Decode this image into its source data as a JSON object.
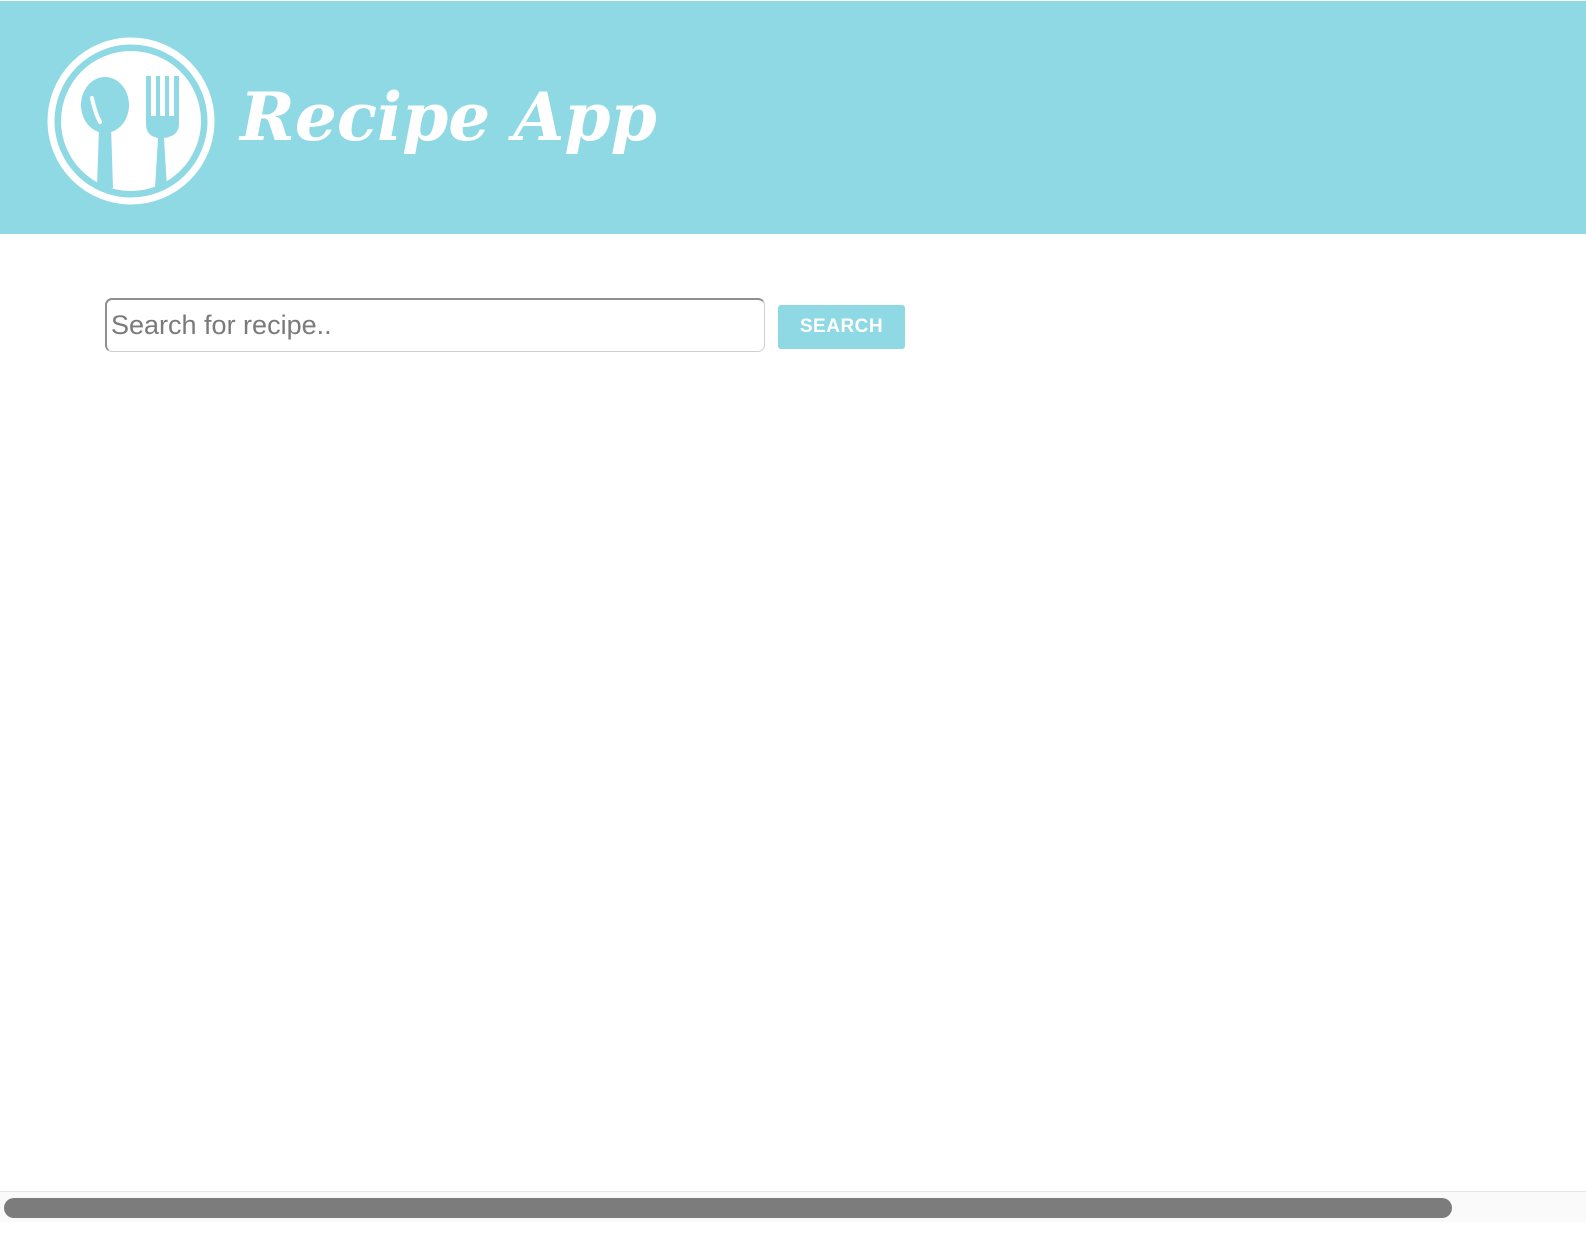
{
  "header": {
    "title": "Recipe App",
    "logo_icon": "spoon-fork-plate-icon",
    "background_color": "#8fd9e5"
  },
  "search": {
    "placeholder": "Search for recipe..",
    "value": "",
    "button_label": "SEARCH",
    "button_color": "#8fd9e5"
  }
}
